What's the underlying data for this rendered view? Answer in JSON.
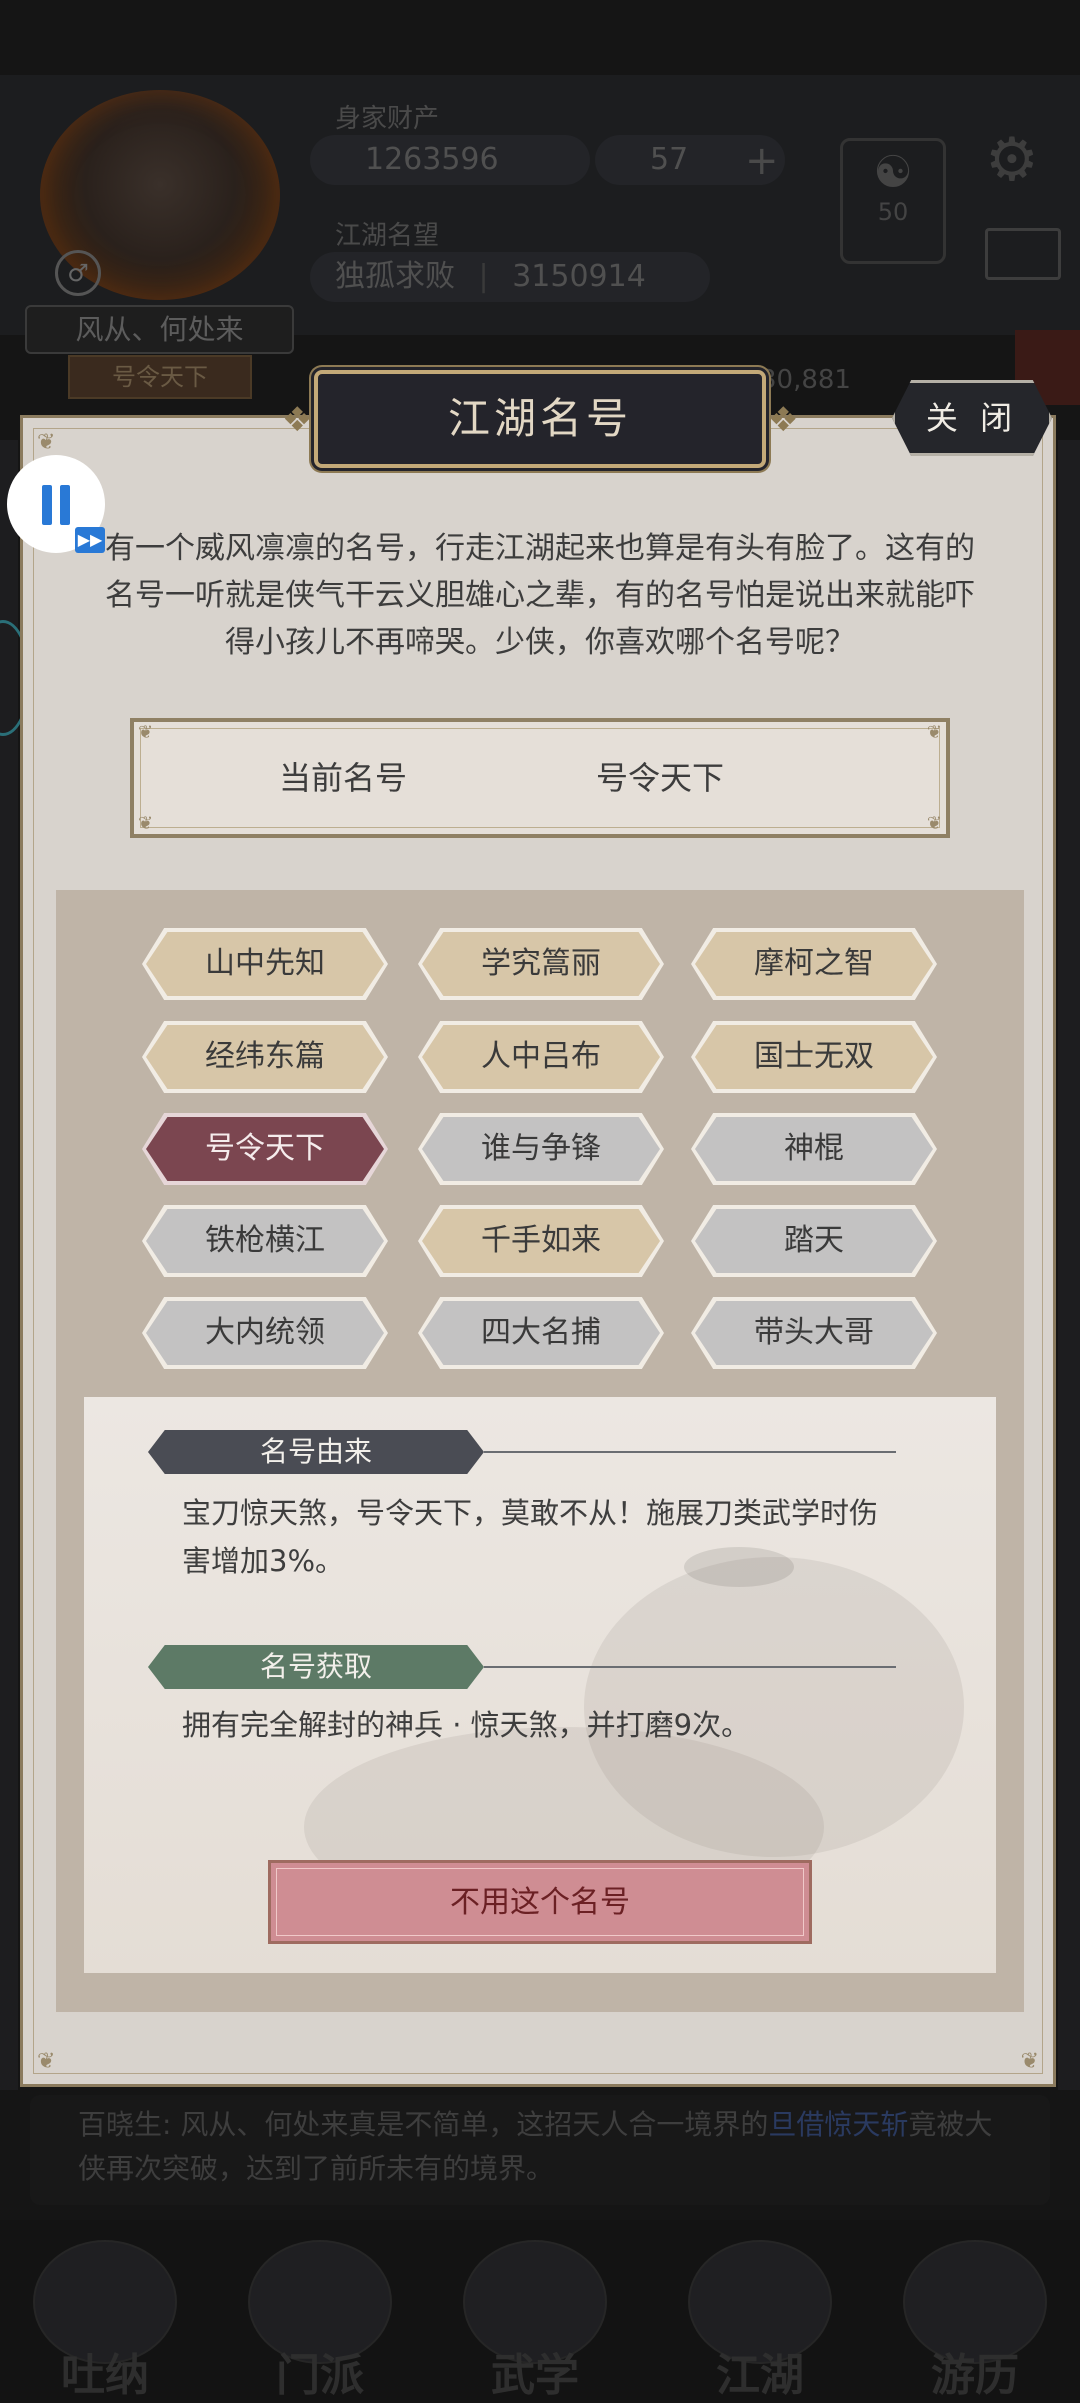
{
  "background": {
    "header": {
      "wealth_label": "身家财产",
      "gold": "1263596",
      "gems": "57",
      "reputation_label": "江湖名望",
      "reputation_title": "独孤求败",
      "reputation_value": "3150914",
      "level": "50",
      "player_name": "风从、何处来",
      "player_title": "号令天下",
      "power": "30,881"
    },
    "news_prefix": "百晓生: 风从、何处来真是不简单，这招天人合一境界的",
    "news_highlight": "旦借惊天斩",
    "news_suffix": "竟被大侠再次突破，达到了前所未有的境界。",
    "nav": [
      "吐纳",
      "门派",
      "武学",
      "江湖",
      "游历"
    ]
  },
  "dialog": {
    "title": "江湖名号",
    "close_label": "关 闭",
    "intro": "有一个威风凛凛的名号，行走江湖起来也算是有头有脸了。这有的名号一听就是侠气干云义胆雄心之辈，有的名号怕是说出来就能吓得小孩儿不再啼哭。少侠，你喜欢哪个名号呢？",
    "current_label": "当前名号",
    "current_value": "号令天下",
    "titles": [
      {
        "label": "山中先知",
        "state": "tan"
      },
      {
        "label": "学究篙丽",
        "state": "tan"
      },
      {
        "label": "摩柯之智",
        "state": "tan"
      },
      {
        "label": "经纬东篇",
        "state": "tan"
      },
      {
        "label": "人中吕布",
        "state": "tan"
      },
      {
        "label": "国士无双",
        "state": "tan"
      },
      {
        "label": "号令天下",
        "state": "selected"
      },
      {
        "label": "谁与争锋",
        "state": "gray"
      },
      {
        "label": "神棍",
        "state": "gray"
      },
      {
        "label": "铁枪横江",
        "state": "gray"
      },
      {
        "label": "千手如来",
        "state": "tan"
      },
      {
        "label": "踏天",
        "state": "gray"
      },
      {
        "label": "大内统领",
        "state": "gray"
      },
      {
        "label": "四大名捕",
        "state": "gray"
      },
      {
        "label": "带头大哥",
        "state": "gray"
      }
    ],
    "origin_header": "名号由来",
    "origin_text": "宝刀惊天煞，号令天下，莫敢不从！施展刀类武学时伤害增加3%。",
    "acquire_header": "名号获取",
    "acquire_text": "拥有完全解封的神兵 · 惊天煞，并打磨9次。",
    "unuse_label": "不用这个名号"
  },
  "colors": {
    "dialog_bg": "#d8d3cd",
    "tag_tan": "#d7c6a8",
    "tag_gray": "#c3c2c2",
    "tag_selected": "#7b4650",
    "origin_tag": "#4a4c54",
    "acquire_tag": "#5d7a66",
    "unuse_button": "#cf8d93"
  }
}
